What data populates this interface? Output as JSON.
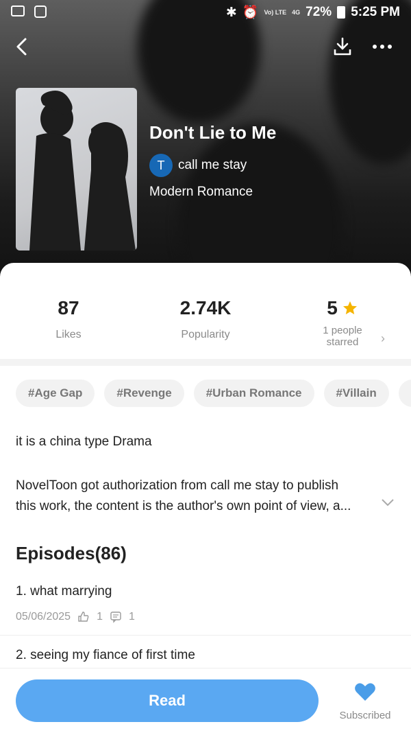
{
  "status_bar": {
    "battery": "72%",
    "time": "5:25 PM",
    "network": "Vo) LTE",
    "signal_small": "4G"
  },
  "header": {
    "back_icon": "back-arrow-icon",
    "download_icon": "download-icon",
    "more_icon": "more-icon"
  },
  "book": {
    "title": "Don't Lie to Me",
    "author_initial": "T",
    "author": "call me stay",
    "genre": "Modern Romance"
  },
  "stats": {
    "likes_value": "87",
    "likes_label": "Likes",
    "popularity_value": "2.74K",
    "popularity_label": "Popularity",
    "rating_value": "5",
    "rating_label_1": "1 people",
    "rating_label_2": "starred"
  },
  "tags": [
    "#Age Gap",
    "#Revenge",
    "#Urban Romance",
    "#Villain"
  ],
  "description": {
    "line1": "it is a china type Drama",
    "line2a": "NovelToon got authorization from call me stay to publish",
    "line2b": "this work, the content is the author's own point of view, a..."
  },
  "episodes": {
    "heading": "Episodes(86)",
    "items": [
      {
        "title": "1. what marrying",
        "date": "05/06/2025",
        "likes": "1",
        "comments": "1"
      },
      {
        "title": "2. seeing my fiance of first time"
      }
    ]
  },
  "footer": {
    "read_label": "Read",
    "subscribed_label": "Subscribed"
  },
  "colors": {
    "accent": "#5aa8f2",
    "heart": "#4a9de8",
    "star": "#f5b400",
    "avatar": "#1768b5"
  }
}
